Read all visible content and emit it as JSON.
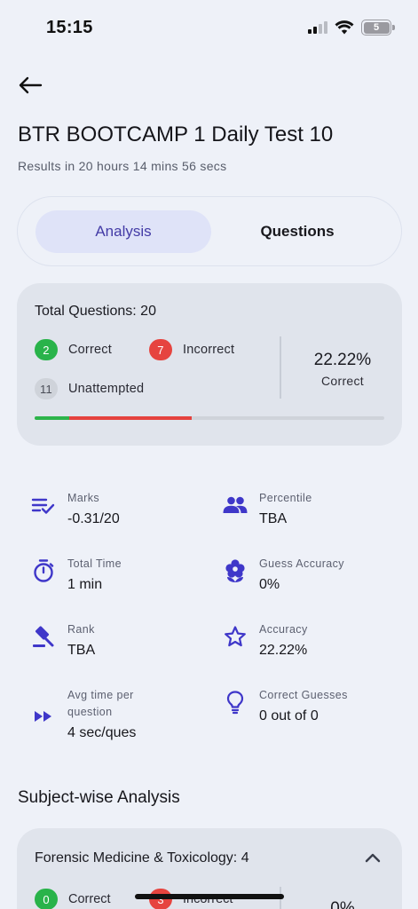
{
  "status_bar": {
    "time": "15:15",
    "battery": "5"
  },
  "header": {
    "title": "BTR BOOTCAMP 1 Daily Test 10",
    "subtitle": "Results in 20 hours 14 mins 56 secs"
  },
  "tabs": [
    {
      "label": "Analysis",
      "active": true
    },
    {
      "label": "Questions",
      "active": false
    }
  ],
  "summary": {
    "total_questions_label": "Total Questions: 20",
    "correct": {
      "count": "2",
      "label": "Correct"
    },
    "incorrect": {
      "count": "7",
      "label": "Incorrect"
    },
    "unattempted": {
      "count": "11",
      "label": "Unattempted"
    },
    "percent": "22.22%",
    "percent_label": "Correct",
    "progress": {
      "correct_fraction": 0.1,
      "incorrect_fraction": 0.35
    }
  },
  "stats": [
    {
      "icon": "checklist-icon",
      "label": "Marks",
      "value": "-0.31/20"
    },
    {
      "icon": "people-icon",
      "label": "Percentile",
      "value": "TBA"
    },
    {
      "icon": "timer-icon",
      "label": "Total Time",
      "value": "1 min"
    },
    {
      "icon": "flower-icon",
      "label": "Guess Accuracy",
      "value": "0%"
    },
    {
      "icon": "gavel-icon",
      "label": "Rank",
      "value": "TBA"
    },
    {
      "icon": "star-icon",
      "label": "Accuracy",
      "value": "22.22%"
    },
    {
      "icon": "fast-forward-icon",
      "label": "Avg time per question",
      "value": "4 sec/ques"
    },
    {
      "icon": "lightbulb-icon",
      "label": "Correct Guesses",
      "value": "0 out of 0"
    }
  ],
  "subject_section": {
    "title": "Subject-wise Analysis",
    "subjects": [
      {
        "name": "Forensic Medicine & Toxicology: 4",
        "correct": {
          "count": "0",
          "label": "Correct"
        },
        "incorrect": {
          "count": "3",
          "label": "Incorrect"
        },
        "percent": "0%"
      }
    ]
  },
  "colors": {
    "accent": "#433ba6",
    "icon": "#3f37c9",
    "correct": "#29b34a",
    "incorrect": "#e6443f",
    "background": "#eef1f8"
  }
}
